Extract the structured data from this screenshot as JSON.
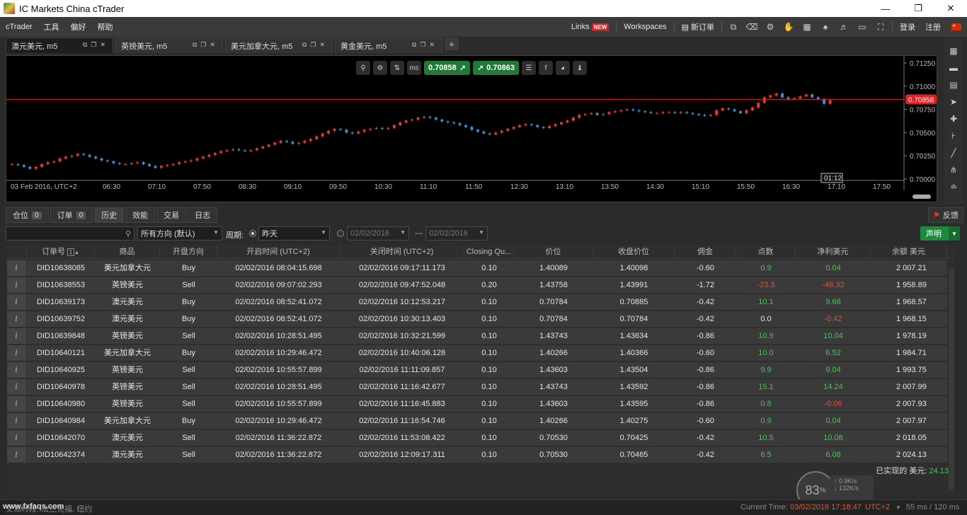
{
  "window": {
    "title": "IC Markets China cTrader"
  },
  "menu": [
    "cTrader",
    "工具",
    "偏好",
    "帮助"
  ],
  "topbar": {
    "links_label": "Links",
    "new_badge": "NEW",
    "workspaces_label": "Workspaces",
    "new_order_label": "新订单",
    "login_label": "登录",
    "register_label": "注册"
  },
  "chart_tabs": [
    {
      "label": "澳元美元, m5"
    },
    {
      "label": "英镑美元, m5"
    },
    {
      "label": "美元加拿大元, m5"
    },
    {
      "label": "黄金美元, m5"
    }
  ],
  "chart_toolbar": {
    "bid": "0.70858",
    "ask": "0.70863"
  },
  "chart_data": {
    "type": "candlestick",
    "symbol": "澳元美元, m5",
    "current_price": 0.70858,
    "current_price_label": "0.70858",
    "ylim": [
      0.7,
      0.7125
    ],
    "y_ticks": [
      "0.71250",
      "0.71000",
      "0.70750",
      "0.70500",
      "0.70250",
      "0.70000"
    ],
    "x_ticks": [
      "03 Feb 2016, UTC+2",
      "06:30",
      "07:10",
      "07:50",
      "08:30",
      "09:10",
      "09:50",
      "10:30",
      "11:10",
      "11:50",
      "12:30",
      "13:10",
      "13:50",
      "14:30",
      "15:10",
      "15:50",
      "16:30",
      "17:10",
      "17:50"
    ],
    "countdown": "01:12",
    "closes": [
      0.7016,
      0.7015,
      0.7013,
      0.7011,
      0.7013,
      0.7016,
      0.7018,
      0.7019,
      0.7022,
      0.7024,
      0.7025,
      0.7027,
      0.7026,
      0.7024,
      0.7022,
      0.702,
      0.7019,
      0.7017,
      0.7016,
      0.7016,
      0.7017,
      0.7018,
      0.7016,
      0.7014,
      0.7012,
      0.7014,
      0.7015,
      0.7016,
      0.7018,
      0.7019,
      0.702,
      0.7022,
      0.7024,
      0.7026,
      0.7028,
      0.703,
      0.7031,
      0.7032,
      0.7031,
      0.703,
      0.7031,
      0.7033,
      0.7035,
      0.7037,
      0.7039,
      0.7041,
      0.704,
      0.7038,
      0.7039,
      0.7041,
      0.7043,
      0.7046,
      0.7049,
      0.7052,
      0.7054,
      0.7053,
      0.705,
      0.7049,
      0.7051,
      0.7053,
      0.7054,
      0.7055,
      0.7054,
      0.7055,
      0.7058,
      0.7061,
      0.7063,
      0.7064,
      0.7066,
      0.7067,
      0.7066,
      0.7064,
      0.7062,
      0.7061,
      0.706,
      0.7058,
      0.7056,
      0.7053,
      0.7051,
      0.7049,
      0.7048,
      0.705,
      0.7052,
      0.7054,
      0.7056,
      0.7058,
      0.7059,
      0.7058,
      0.7056,
      0.7055,
      0.7057,
      0.7059,
      0.7061,
      0.7063,
      0.7066,
      0.7069,
      0.707,
      0.7071,
      0.7069,
      0.707,
      0.7072,
      0.7073,
      0.7074,
      0.7075,
      0.7074,
      0.7073,
      0.7072,
      0.7071,
      0.7071,
      0.7072,
      0.7072,
      0.7071,
      0.7072,
      0.7071,
      0.707,
      0.7069,
      0.7068,
      0.7069,
      0.7074,
      0.7076,
      0.7075,
      0.7073,
      0.7071,
      0.7074,
      0.7077,
      0.7082,
      0.7088,
      0.709,
      0.7092,
      0.7088,
      0.7086,
      0.7087,
      0.7089,
      0.7091,
      0.7088,
      0.7086,
      0.7081,
      0.7085
    ]
  },
  "bottom_tabs": [
    {
      "label": "仓位",
      "count": "0"
    },
    {
      "label": "订单",
      "count": "0"
    },
    {
      "label": "历史"
    },
    {
      "label": "效能"
    },
    {
      "label": "交易"
    },
    {
      "label": "日志"
    }
  ],
  "feedback_label": "反馈",
  "filter": {
    "search_placeholder": "",
    "direction": "所有方向 (默认)",
    "period_label": "周期:",
    "period_value": "昨天",
    "date_from": "02/02/2016",
    "date_sep": "—",
    "date_to": "02/02/2016",
    "declare_label": "声明"
  },
  "table": {
    "sort_index": "1",
    "columns": [
      "订单号",
      "商品",
      "开盘方向",
      "开启时间 (UTC+2)",
      "关闭时间 (UTC+2)",
      "Closing Qu...",
      "价位",
      "收盘价位",
      "佣金",
      "点数",
      "净利美元",
      "余额 美元"
    ],
    "rows": [
      [
        "DID10638085",
        "美元加拿大元",
        "Buy",
        "02/02/2016 08:04:15.698",
        "02/02/2016 09:17:11.173",
        "0.10",
        "1.40089",
        "1.40098",
        "-0.60",
        "0.9",
        "0.04",
        "2 007.21"
      ],
      [
        "DID10638553",
        "英镑美元",
        "Sell",
        "02/02/2016 09:07:02.293",
        "02/02/2016 09:47:52.048",
        "0.20",
        "1.43758",
        "1.43991",
        "-1.72",
        "-23.3",
        "-48.32",
        "1 958.89"
      ],
      [
        "DID10639173",
        "澳元美元",
        "Buy",
        "02/02/2016 08:52:41.072",
        "02/02/2016 10:12:53.217",
        "0.10",
        "0.70784",
        "0.70885",
        "-0.42",
        "10.1",
        "9.68",
        "1 968.57"
      ],
      [
        "DID10639752",
        "澳元美元",
        "Buy",
        "02/02/2016 08:52:41.072",
        "02/02/2016 10:30:13.403",
        "0.10",
        "0.70784",
        "0.70784",
        "-0.42",
        "0.0",
        "-0.42",
        "1 968.15"
      ],
      [
        "DID10639848",
        "英镑美元",
        "Sell",
        "02/02/2016 10:28:51.495",
        "02/02/2016 10:32:21.599",
        "0.10",
        "1.43743",
        "1.43634",
        "-0.86",
        "10.9",
        "10.04",
        "1 978.19"
      ],
      [
        "DID10640121",
        "美元加拿大元",
        "Buy",
        "02/02/2016 10:29:46.472",
        "02/02/2016 10:40:06.128",
        "0.10",
        "1.40266",
        "1.40366",
        "-0.60",
        "10.0",
        "6.52",
        "1 984.71"
      ],
      [
        "DID10640925",
        "英镑美元",
        "Sell",
        "02/02/2016 10:55:57.899",
        "02/02/2016 11:11:09.857",
        "0.10",
        "1.43603",
        "1.43504",
        "-0.86",
        "9.9",
        "9.04",
        "1 993.75"
      ],
      [
        "DID10640978",
        "英镑美元",
        "Sell",
        "02/02/2016 10:28:51.495",
        "02/02/2016 11:16:42.677",
        "0.10",
        "1.43743",
        "1.43592",
        "-0.86",
        "15.1",
        "14.24",
        "2 007.99"
      ],
      [
        "DID10640980",
        "英镑美元",
        "Sell",
        "02/02/2016 10:55:57.899",
        "02/02/2016 11:16:45.883",
        "0.10",
        "1.43603",
        "1.43595",
        "-0.86",
        "0.8",
        "-0.06",
        "2 007.93"
      ],
      [
        "DID10640984",
        "美元加拿大元",
        "Buy",
        "02/02/2016 10:29:46.472",
        "02/02/2016 11:16:54.746",
        "0.10",
        "1.40266",
        "1.40275",
        "-0.60",
        "0.9",
        "0.04",
        "2 007.97"
      ],
      [
        "DID10642070",
        "澳元美元",
        "Sell",
        "02/02/2016 11:36:22.872",
        "02/02/2016 11:53:08.422",
        "0.10",
        "0.70530",
        "0.70425",
        "-0.42",
        "10.5",
        "10.08",
        "2 018.05"
      ],
      [
        "DID10642374",
        "澳元美元",
        "Sell",
        "02/02/2016 11:36:22.872",
        "02/02/2016 12:09:17.311",
        "0.10",
        "0.70530",
        "0.70465",
        "-0.42",
        "6.5",
        "6.08",
        "2 024.13"
      ]
    ]
  },
  "realized": {
    "label": "已实现的 美元:",
    "value": "24.13"
  },
  "network": {
    "percent": "83",
    "up": "0.9",
    "up_unit": "K/s",
    "down": "132",
    "down_unit": "K/s"
  },
  "status": {
    "left": "交易时段: 法兰克福, 纽约",
    "watermark": "www.fxfaqs.com",
    "time_label": "Current Time:",
    "time_value": "03/02/2016 17:18:47",
    "tz": "UTC+2",
    "latency": "55 ms / 120 ms"
  },
  "colors": {
    "up_candle": "#e53935",
    "down_candle": "#3b8fd9",
    "price_line": "#e01f1f",
    "accent_green": "#1f8a3c"
  }
}
